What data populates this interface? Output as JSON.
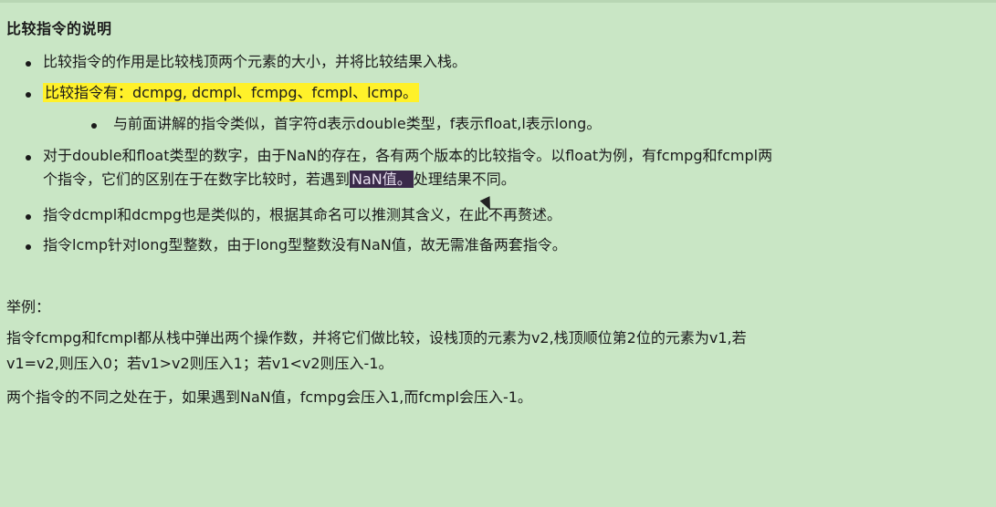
{
  "heading": "比较指令的说明",
  "bullets": [
    {
      "text": "比较指令的作用是比较栈顶两个元素的大小，并将比较结果入栈。"
    },
    {
      "text": "比较指令有：dcmpg, dcmpl、fcmpg、fcmpl、lcmp。"
    },
    {
      "text": "与前面讲解的指令类似，首字符d表示double类型，f表示float,l表示long。"
    },
    {
      "line1": "对于double和float类型的数字，由于NaN的存在，各有两个版本的比较指令。以float为例，有fcmpg和fcmpl两",
      "line2_before": "个指令，它们的区别在于在数字比较时，若遇到",
      "line2_sel": "NaN值。",
      "line2_after": "处理结果不同。"
    },
    {
      "text": "指令dcmpl和dcmpg也是类似的，根据其命名可以推测其含义，在此不再赘述。"
    },
    {
      "text": "指令lcmp针对long型整数，由于long型整数没有NaN值，故无需准备两套指令。"
    }
  ],
  "example": {
    "title": "举例：",
    "line1": "指令fcmpg和fcmpl都从栈中弹出两个操作数，并将它们做比较，设栈顶的元素为v2,栈顶顺位第2位的元素为v1,若",
    "line2": "v1=v2,则压入0；若v1>v2则压入1；若v1<v2则压入-1。",
    "line3": "两个指令的不同之处在于，如果遇到NaN值，fcmpg会压入1,而fcmpl会压入-1。"
  }
}
